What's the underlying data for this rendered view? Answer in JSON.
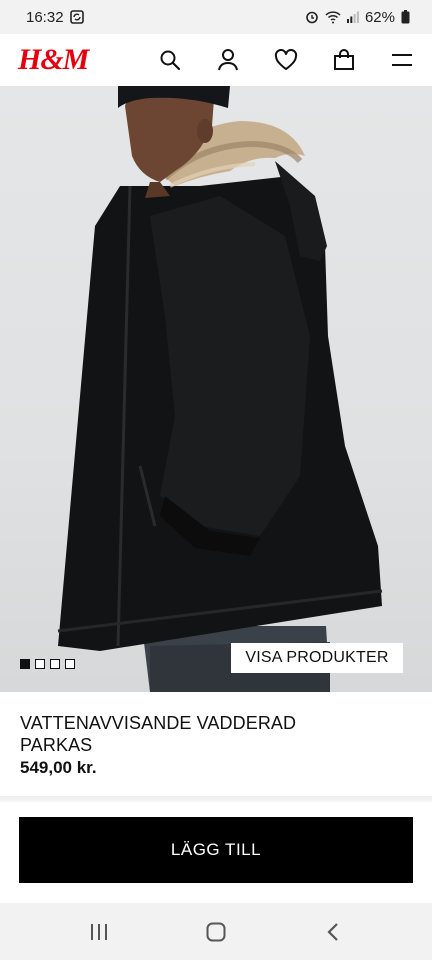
{
  "status_bar": {
    "time": "16:32",
    "battery": "62%",
    "icons": [
      "sync-icon",
      "alarm-icon",
      "wifi-icon",
      "signal-icon",
      "battery-icon"
    ]
  },
  "header": {
    "logo": "H&M",
    "icons": [
      "search-icon",
      "account-icon",
      "favorites-icon",
      "shopping-bag-icon",
      "menu-icon"
    ],
    "brand_color": "#e50010"
  },
  "hero": {
    "cta_label": "VISA PRODUKTER",
    "pager_total": 4,
    "pager_active": 1
  },
  "product": {
    "title": "VATTENAVVISANDE VADDERAD PARKAS",
    "price": "549,00 kr."
  },
  "actions": {
    "add_to_cart_label": "LÄGG TILL"
  },
  "nav_bar": {
    "icons": [
      "recent-apps-icon",
      "home-icon",
      "back-icon"
    ]
  }
}
